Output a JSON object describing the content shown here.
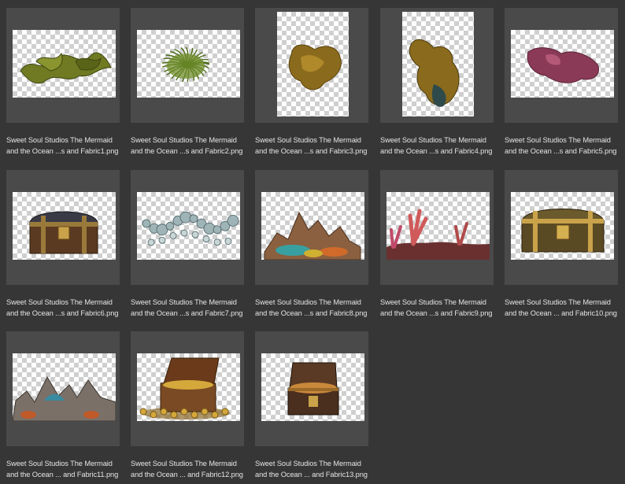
{
  "files": [
    {
      "line1": "Sweet Soul Studios The Mermaid",
      "line2": "and the Ocean ...s and Fabric1.png",
      "icon": "seaweed-icon"
    },
    {
      "line1": "Sweet Soul Studios The Mermaid",
      "line2": "and the Ocean ...s and Fabric2.png",
      "icon": "seaweed-clump-icon"
    },
    {
      "line1": "Sweet Soul Studios The Mermaid",
      "line2": "and the Ocean ...s and Fabric3.png",
      "icon": "gold-fabric-icon"
    },
    {
      "line1": "Sweet Soul Studios The Mermaid",
      "line2": "and the Ocean ...s and Fabric4.png",
      "icon": "gold-fabric-icon"
    },
    {
      "line1": "Sweet Soul Studios The Mermaid",
      "line2": "and the Ocean ...s and Fabric5.png",
      "icon": "pink-fabric-icon"
    },
    {
      "line1": "Sweet Soul Studios The Mermaid",
      "line2": "and the Ocean ...s and Fabric6.png",
      "icon": "treasure-chest-icon"
    },
    {
      "line1": "Sweet Soul Studios The Mermaid",
      "line2": "and the Ocean ...s and Fabric7.png",
      "icon": "crystal-garland-icon"
    },
    {
      "line1": "Sweet Soul Studios The Mermaid",
      "line2": "and the Ocean ...s and Fabric8.png",
      "icon": "coral-reef-icon"
    },
    {
      "line1": "Sweet Soul Studios The Mermaid",
      "line2": "and the Ocean ...s and Fabric9.png",
      "icon": "coral-reef-icon"
    },
    {
      "line1": "Sweet Soul Studios The Mermaid",
      "line2": "and the Ocean ... and Fabric10.png",
      "icon": "treasure-chest-icon"
    },
    {
      "line1": "Sweet Soul Studios The Mermaid",
      "line2": "and the Ocean ... and Fabric11.png",
      "icon": "coral-reef-icon"
    },
    {
      "line1": "Sweet Soul Studios The Mermaid",
      "line2": "and the Ocean ... and Fabric12.png",
      "icon": "open-treasure-chest-icon"
    },
    {
      "line1": "Sweet Soul Studios The Mermaid",
      "line2": "and the Ocean ... and Fabric13.png",
      "icon": "open-treasure-chest-icon"
    }
  ]
}
